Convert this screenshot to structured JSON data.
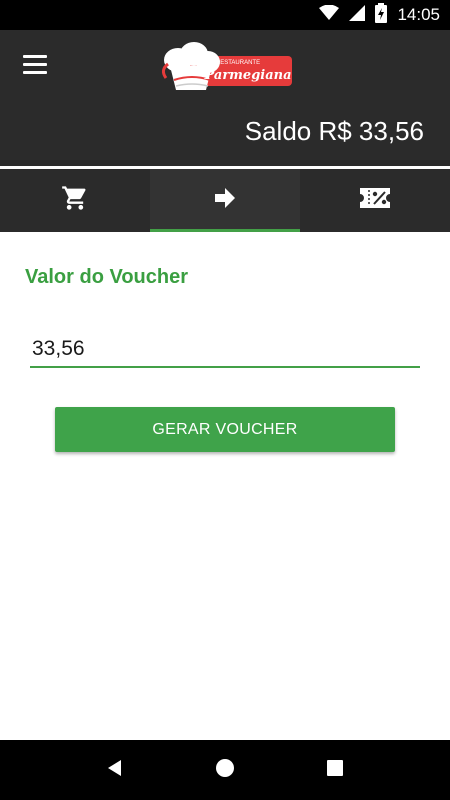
{
  "status_bar": {
    "time": "14:05",
    "icons": [
      "wifi-icon",
      "signal-icon",
      "battery-charging-icon"
    ]
  },
  "header": {
    "logo": {
      "top_text": "RESTAURANTE",
      "brand_text": "Parmegiana"
    },
    "balance_label": "Saldo R$ 33,56"
  },
  "tabs": [
    {
      "icon": "cart-icon",
      "active": false
    },
    {
      "icon": "arrow-right-icon",
      "active": true
    },
    {
      "icon": "ticket-percent-icon",
      "active": false
    }
  ],
  "voucher": {
    "title": "Valor do Voucher",
    "amount_value": "33,56",
    "generate_label": "GERAR VOUCHER"
  },
  "colors": {
    "accent_green": "#43a047",
    "appbar_bg": "#2b2b2b",
    "logo_red": "#e63b3b"
  },
  "nav_bar": {
    "icons": [
      "back-icon",
      "home-icon",
      "recents-icon"
    ]
  }
}
